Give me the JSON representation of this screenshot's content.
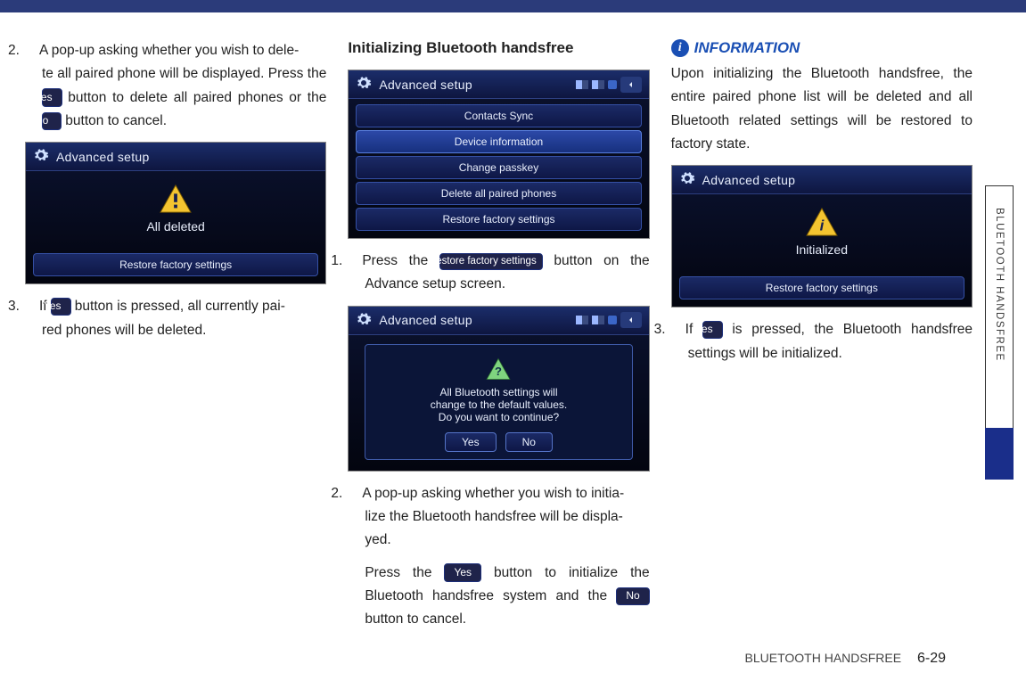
{
  "buttons": {
    "yes": "Yes",
    "no": "No",
    "restore": "Restore factory settings"
  },
  "side_label": "BLUETOOTH HANDSFREE",
  "footer": {
    "section": "BLUETOOTH HANDSFREE",
    "page": "6-29"
  },
  "col1": {
    "s2a": "A pop-up asking whether you wish to dele-",
    "s2b": "te all paired phone will be displayed. Press the ",
    "s2c": " button to delete all paired phones or the ",
    "s2d": " button to cancel.",
    "shot1_title": "Advanced setup",
    "shot1_msg": "All deleted",
    "shot1_btn": "Restore factory settings",
    "s3a": "If ",
    "s3b": " button is pressed, all currently pai-",
    "s3c": "red phones will be deleted."
  },
  "col2": {
    "heading": "Initializing Bluetooth handsfree",
    "shotA_title": "Advanced setup",
    "menu": [
      "Contacts Sync",
      "Device information",
      "Change passkey",
      "Delete all paired phones",
      "Restore factory settings"
    ],
    "s1a": "Press the ",
    "s1b": " button on the Advance setup screen.",
    "shotB_title": "Advanced setup",
    "popup_l1": "All Bluetooth settings will",
    "popup_l2": "change to the default values.",
    "popup_l3": "Do you want to continue?",
    "popup_yes": "Yes",
    "popup_no": "No",
    "s2a": "A pop-up asking whether you wish to initia-",
    "s2b": "lize the Bluetooth handsfree will be displa-",
    "s2c": "yed.",
    "s2d": "Press the ",
    "s2e": "  button to initialize the Bluetooth handsfree system and the ",
    "s2f": " button to cancel."
  },
  "col3": {
    "info_title": "INFORMATION",
    "info_body": "Upon initializing the Bluetooth handsfree, the entire paired phone list will be deleted and all Bluetooth related settings will be restored to factory state.",
    "shot_title": "Advanced setup",
    "shot_msg": "Initialized",
    "shot_btn": "Restore factory settings",
    "s3a": "If ",
    "s3b": " is pressed, the Bluetooth handsfree settings will be initialized."
  }
}
